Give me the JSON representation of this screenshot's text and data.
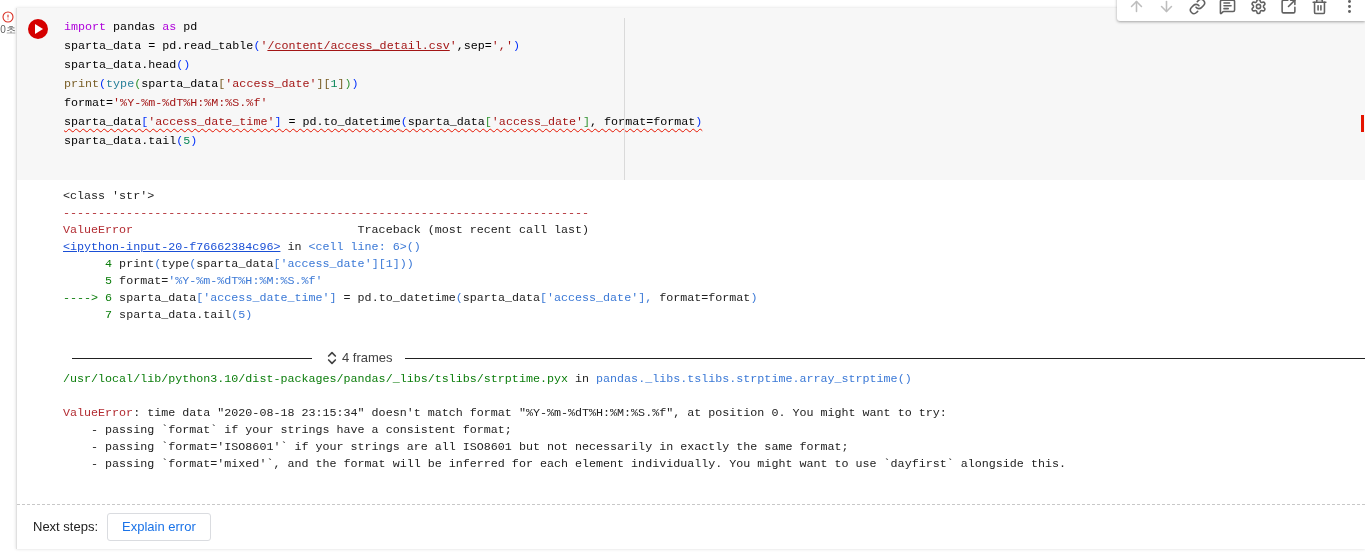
{
  "gutter": {
    "error": true,
    "elapsed": "0초"
  },
  "toolbar": [
    {
      "kind": "up",
      "disabled": true
    },
    {
      "kind": "down",
      "disabled": true
    },
    {
      "kind": "link",
      "disabled": false
    },
    {
      "kind": "comment",
      "disabled": false
    },
    {
      "kind": "settings",
      "disabled": false
    },
    {
      "kind": "mirror",
      "disabled": false
    },
    {
      "kind": "delete",
      "disabled": false
    },
    {
      "kind": "more",
      "disabled": false
    }
  ],
  "code": {
    "lines": [
      {
        "squiggle": false,
        "tokens": [
          {
            "text": "import",
            "kind": "kw"
          },
          {
            "text": " pandas ",
            "kind": "p"
          },
          {
            "text": "as",
            "kind": "kw"
          },
          {
            "text": " pd",
            "kind": "p"
          }
        ]
      },
      {
        "squiggle": false,
        "tokens": [
          {
            "text": "sparta_data = pd.read_table",
            "kind": "p"
          },
          {
            "text": "(",
            "kind": "par"
          },
          {
            "text": "'",
            "kind": "str"
          },
          {
            "text": "/content/access_detail.csv",
            "kind": "link"
          },
          {
            "text": "'",
            "kind": "str"
          },
          {
            "text": ",sep=",
            "kind": "p"
          },
          {
            "text": "','",
            "kind": "str"
          },
          {
            "text": ")",
            "kind": "par"
          }
        ]
      },
      {
        "squiggle": false,
        "tokens": [
          {
            "text": "sparta_data.head",
            "kind": "p"
          },
          {
            "text": "()",
            "kind": "par"
          }
        ]
      },
      {
        "squiggle": false,
        "tokens": [
          {
            "text": "print",
            "kind": "fn"
          },
          {
            "text": "(",
            "kind": "par"
          },
          {
            "text": "type",
            "kind": "ty"
          },
          {
            "text": "(",
            "kind": "br"
          },
          {
            "text": "sparta_data",
            "kind": "p"
          },
          {
            "text": "[",
            "kind": "fn"
          },
          {
            "text": "'access_date'",
            "kind": "str"
          },
          {
            "text": "][",
            "kind": "fn"
          },
          {
            "text": "1",
            "kind": "num"
          },
          {
            "text": "]",
            "kind": "fn"
          },
          {
            "text": ")",
            "kind": "br"
          },
          {
            "text": ")",
            "kind": "par"
          }
        ]
      },
      {
        "squiggle": false,
        "tokens": [
          {
            "text": "format=",
            "kind": "p"
          },
          {
            "text": "'%Y-%m-%dT%H:%M:%S.%f'",
            "kind": "str"
          }
        ]
      },
      {
        "squiggle": true,
        "tokens": [
          {
            "text": "sparta_data",
            "kind": "p"
          },
          {
            "text": "[",
            "kind": "par"
          },
          {
            "text": "'access_date_time'",
            "kind": "str"
          },
          {
            "text": "]",
            "kind": "par"
          },
          {
            "text": " = pd.to_datetime",
            "kind": "p"
          },
          {
            "text": "(",
            "kind": "par"
          },
          {
            "text": "sparta_data",
            "kind": "p"
          },
          {
            "text": "[",
            "kind": "br"
          },
          {
            "text": "'access_date'",
            "kind": "str"
          },
          {
            "text": "]",
            "kind": "br"
          },
          {
            "text": ", format=format",
            "kind": "p"
          },
          {
            "text": ")",
            "kind": "par"
          }
        ]
      },
      {
        "squiggle": false,
        "tokens": [
          {
            "text": "sparta_data.tail",
            "kind": "p"
          },
          {
            "text": "(",
            "kind": "par"
          },
          {
            "text": "5",
            "kind": "num"
          },
          {
            "text": ")",
            "kind": "par"
          }
        ]
      }
    ]
  },
  "output": {
    "traceback": [
      {
        "tokens": [
          {
            "text": "<class 'str'>",
            "kind": "p"
          }
        ]
      },
      {
        "tokens": [
          {
            "text": "---------------------------------------------------------------------------",
            "kind": "red"
          }
        ]
      },
      {
        "tokens": [
          {
            "text": "ValueError",
            "kind": "red"
          },
          {
            "text": "                                Traceback (most recent call last)",
            "kind": "p"
          }
        ]
      },
      {
        "tokens": [
          {
            "text": "<ipython-input-20-f76662384c96>",
            "kind": "link"
          },
          {
            "text": " in ",
            "kind": "p"
          },
          {
            "text": "<cell line: 6>()",
            "kind": "blue"
          }
        ]
      },
      {
        "tokens": [
          {
            "text": "      4",
            "kind": "green"
          },
          {
            "text": " print",
            "kind": "p"
          },
          {
            "text": "(",
            "kind": "blue"
          },
          {
            "text": "type",
            "kind": "p"
          },
          {
            "text": "(",
            "kind": "blue"
          },
          {
            "text": "sparta_data",
            "kind": "p"
          },
          {
            "text": "['access_date'][1]))",
            "kind": "blue"
          }
        ]
      },
      {
        "tokens": [
          {
            "text": "      5",
            "kind": "green"
          },
          {
            "text": " format=",
            "kind": "p"
          },
          {
            "text": "'%Y-%m-%dT%H:%M:%S.%f'",
            "kind": "blue"
          }
        ]
      },
      {
        "tokens": [
          {
            "text": "----> 6",
            "kind": "green"
          },
          {
            "text": " sparta_data",
            "kind": "p"
          },
          {
            "text": "['access_date_time']",
            "kind": "blue"
          },
          {
            "text": " = pd.to_datetime",
            "kind": "p"
          },
          {
            "text": "(",
            "kind": "blue"
          },
          {
            "text": "sparta_data",
            "kind": "p"
          },
          {
            "text": "['access_date'],",
            "kind": "blue"
          },
          {
            "text": " format=format",
            "kind": "p"
          },
          {
            "text": ")",
            "kind": "blue"
          }
        ]
      },
      {
        "tokens": [
          {
            "text": "      7",
            "kind": "green"
          },
          {
            "text": " sparta_data.tail",
            "kind": "p"
          },
          {
            "text": "(5)",
            "kind": "blue"
          }
        ]
      }
    ],
    "frames": "4 frames",
    "frame_line": {
      "tokens": [
        {
          "text": "/usr/local/lib/python3.10/dist-packages/pandas/_libs/tslibs/strptime.pyx",
          "kind": "green"
        },
        {
          "text": " in ",
          "kind": "p"
        },
        {
          "text": "pandas._libs.tslibs.strptime.array_strptime()",
          "kind": "blue"
        }
      ]
    },
    "error": [
      {
        "tokens": [
          {
            "text": "ValueError",
            "kind": "red"
          },
          {
            "text": ": time data \"2020-08-18 23:15:34\" doesn't match format \"%Y-%m-%dT%H:%M:%S.%f\", at position 0. You might want to try:",
            "kind": "p"
          }
        ]
      },
      {
        "tokens": [
          {
            "text": "    - passing `format` if your strings have a consistent format;",
            "kind": "p"
          }
        ]
      },
      {
        "tokens": [
          {
            "text": "    - passing `format='ISO8601'` if your strings are all ISO8601 but not necessarily in exactly the same format;",
            "kind": "p"
          }
        ]
      },
      {
        "tokens": [
          {
            "text": "    - passing `format='mixed'`, and the format will be inferred for each element individually. You might want to use `dayfirst` alongside this.",
            "kind": "p"
          }
        ]
      }
    ]
  },
  "next_steps": {
    "label": "Next steps:",
    "button": "Explain error"
  }
}
